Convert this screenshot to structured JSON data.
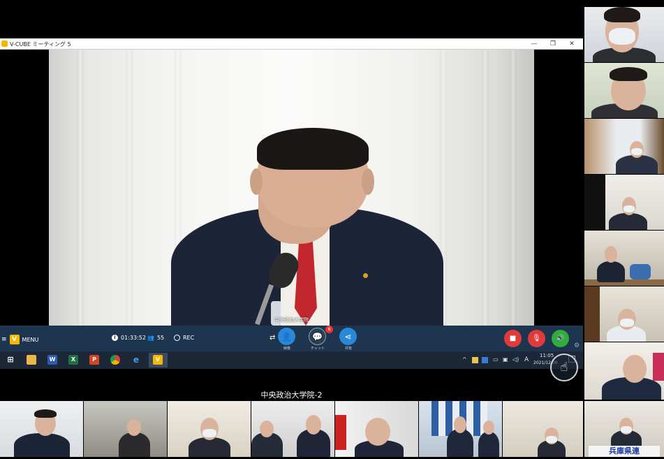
{
  "window": {
    "title": "V-CUBE ミーティング 5",
    "controls": {
      "minimize": "—",
      "maximize": "❐",
      "close": "✕"
    }
  },
  "main_video": {
    "name_caption": "中央政治大学院"
  },
  "toolbar": {
    "menu_label": "MENU",
    "elapsed_time": "01:33:52",
    "participant_count": "55",
    "rec_label": "REC",
    "video_label": "映像",
    "chat_label": "チャット",
    "chat_badge": "6",
    "share_label": "共有",
    "colors": {
      "background": "#1e3550",
      "video_btn": "#2a88d8",
      "hangup": "#e03a3a",
      "mic_off": "#e03a3a",
      "speaker": "#2fae3a",
      "badge": "#e33"
    }
  },
  "taskbar": {
    "apps": [
      {
        "icon": "windows-start-icon"
      },
      {
        "icon": "file-explorer-icon"
      },
      {
        "icon": "word-icon",
        "glyph": "W"
      },
      {
        "icon": "excel-icon",
        "glyph": "X"
      },
      {
        "icon": "powerpoint-icon",
        "glyph": "P"
      },
      {
        "icon": "chrome-icon"
      },
      {
        "icon": "internet-explorer-icon",
        "glyph": "e"
      },
      {
        "icon": "vcube-icon",
        "glyph": "V"
      }
    ],
    "ime_label": "A",
    "clock_time": "11:05",
    "clock_date": "2021/12/06"
  },
  "active_speaker_label": "中央政治大学院-2",
  "bottom_thumb_captions": {
    "hyogo_sign": "兵庫県連"
  }
}
